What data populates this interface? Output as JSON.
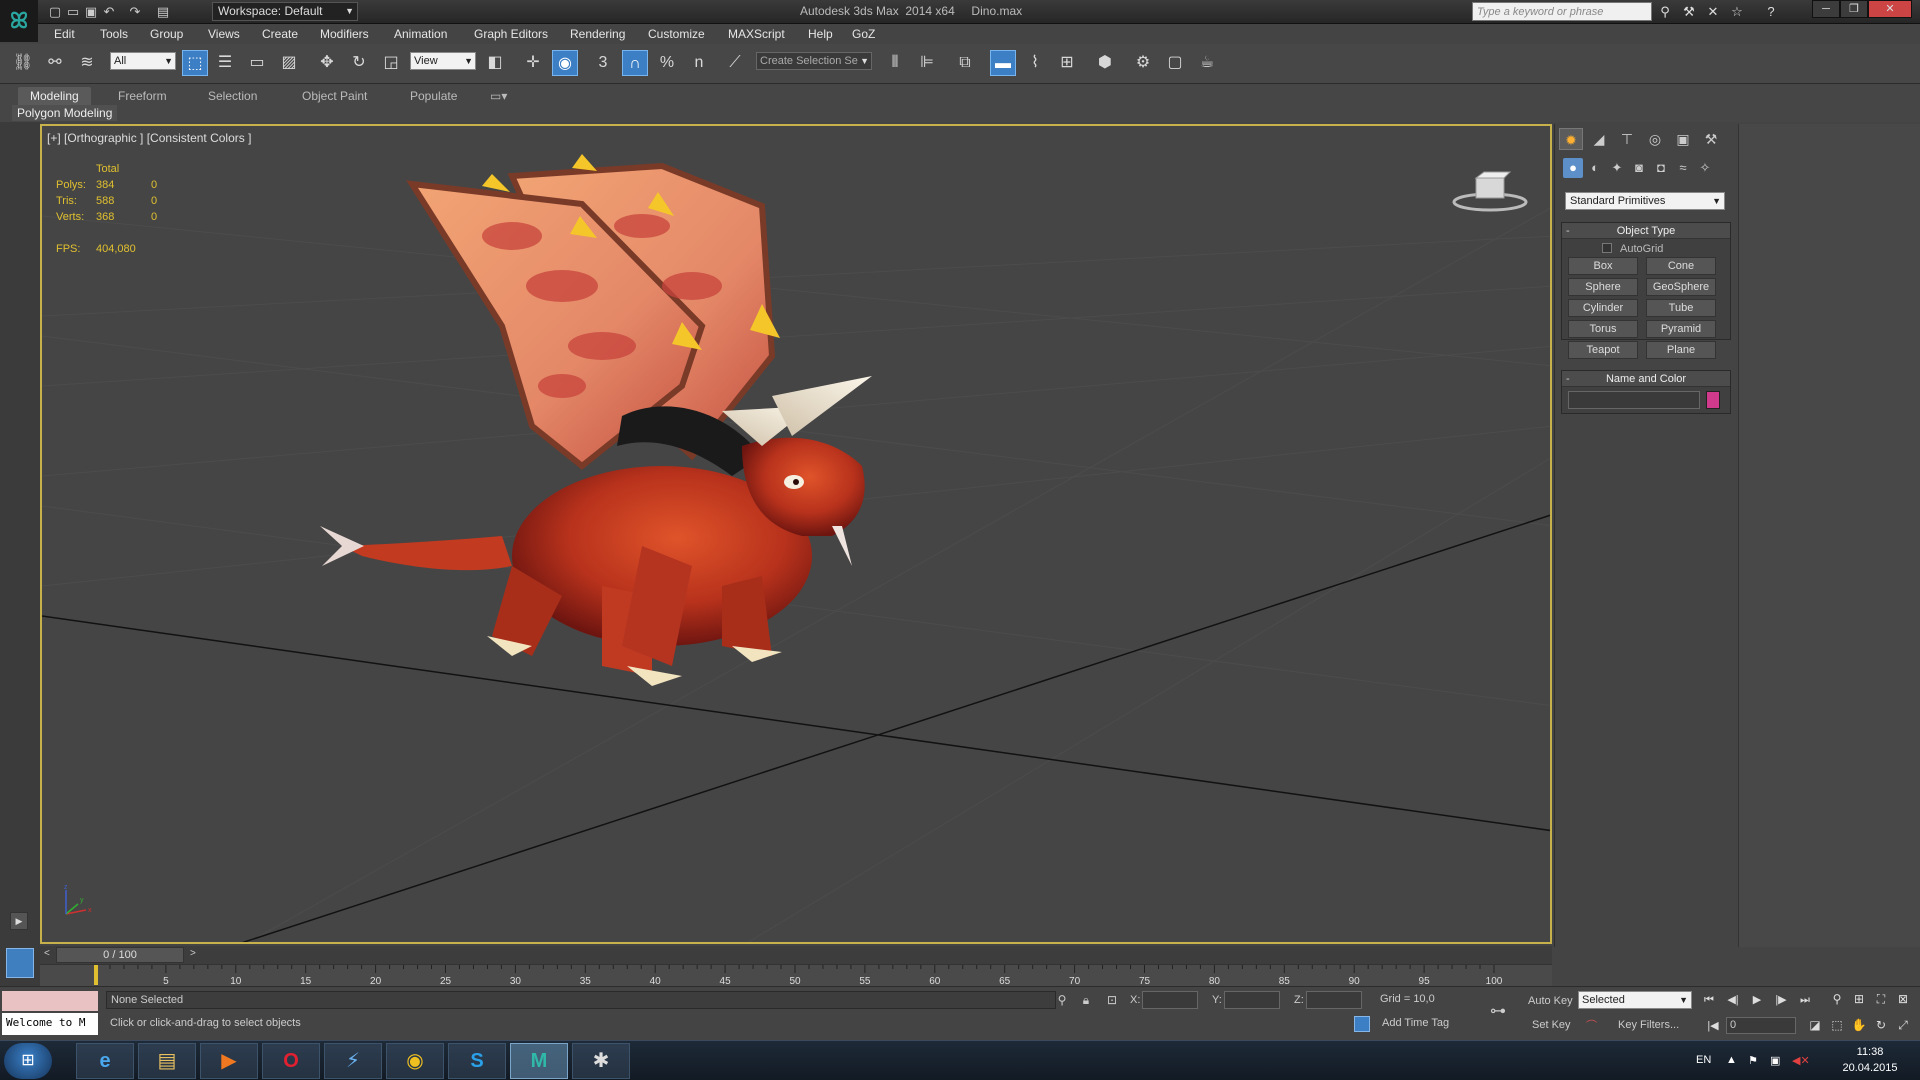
{
  "titlebar": {
    "workspace": "Workspace: Default",
    "title": "Autodesk 3ds Max  2014 x64     Dino.max",
    "search_placeholder": "Type a keyword or phrase"
  },
  "menu": [
    "Edit",
    "Tools",
    "Group",
    "Views",
    "Create",
    "Modifiers",
    "Animation",
    "Graph Editors",
    "Rendering",
    "Customize",
    "MAXScript",
    "Help",
    "GoZ"
  ],
  "toolbar": {
    "selection_filter": "All",
    "ref_coord": "View",
    "named_selection": "Create Selection Se",
    "snap_label": "3",
    "angle_snap_label": "%",
    "spinner_snap_label": "n"
  },
  "ribbon": {
    "tabs": [
      "Modeling",
      "Freeform",
      "Selection",
      "Object Paint",
      "Populate"
    ],
    "active_tab": "Modeling",
    "sub_label": "Polygon Modeling"
  },
  "viewport": {
    "label": "[+] [Orthographic ] [Consistent Colors ]",
    "stats": {
      "total_header": "Total",
      "rows": [
        {
          "label": "Polys:",
          "total": "384",
          "sel": "0"
        },
        {
          "label": "Tris:",
          "total": "588",
          "sel": "0"
        },
        {
          "label": "Verts:",
          "total": "368",
          "sel": "0"
        }
      ],
      "fps_label": "FPS:",
      "fps_value": "404,080"
    },
    "axis_x": "x",
    "axis_y": "y",
    "axis_z": "z"
  },
  "command_panel": {
    "category": "Standard Primitives",
    "object_type_title": "Object Type",
    "autogrid": "AutoGrid",
    "primitives": [
      "Box",
      "Cone",
      "Sphere",
      "GeoSphere",
      "Cylinder",
      "Tube",
      "Torus",
      "Pyramid",
      "Teapot",
      "Plane"
    ],
    "name_color_title": "Name and Color",
    "object_color": "#d03a8c"
  },
  "timeline": {
    "slider_label": "0 / 100",
    "ticks": [
      "5",
      "10",
      "15",
      "20",
      "25",
      "30",
      "35",
      "40",
      "45",
      "50",
      "55",
      "60",
      "65",
      "70",
      "75",
      "80",
      "85",
      "90",
      "95",
      "100"
    ]
  },
  "status": {
    "listener": "Welcome to M",
    "selection": "None Selected",
    "prompt": "Click or click-and-drag to select objects",
    "x_label": "X:",
    "y_label": "Y:",
    "z_label": "Z:",
    "grid": "Grid = 10,0",
    "add_time_tag": "Add Time Tag",
    "auto_key": "Auto Key",
    "set_key": "Set Key",
    "key_mode": "Selected",
    "key_filters": "Key Filters...",
    "frame": "0"
  },
  "taskbar": {
    "lang": "EN",
    "time": "11:38",
    "date": "20.04.2015",
    "apps": [
      "e",
      "▤",
      "▶",
      "O",
      "⚡",
      "◉",
      "S",
      "M",
      "✱"
    ]
  }
}
